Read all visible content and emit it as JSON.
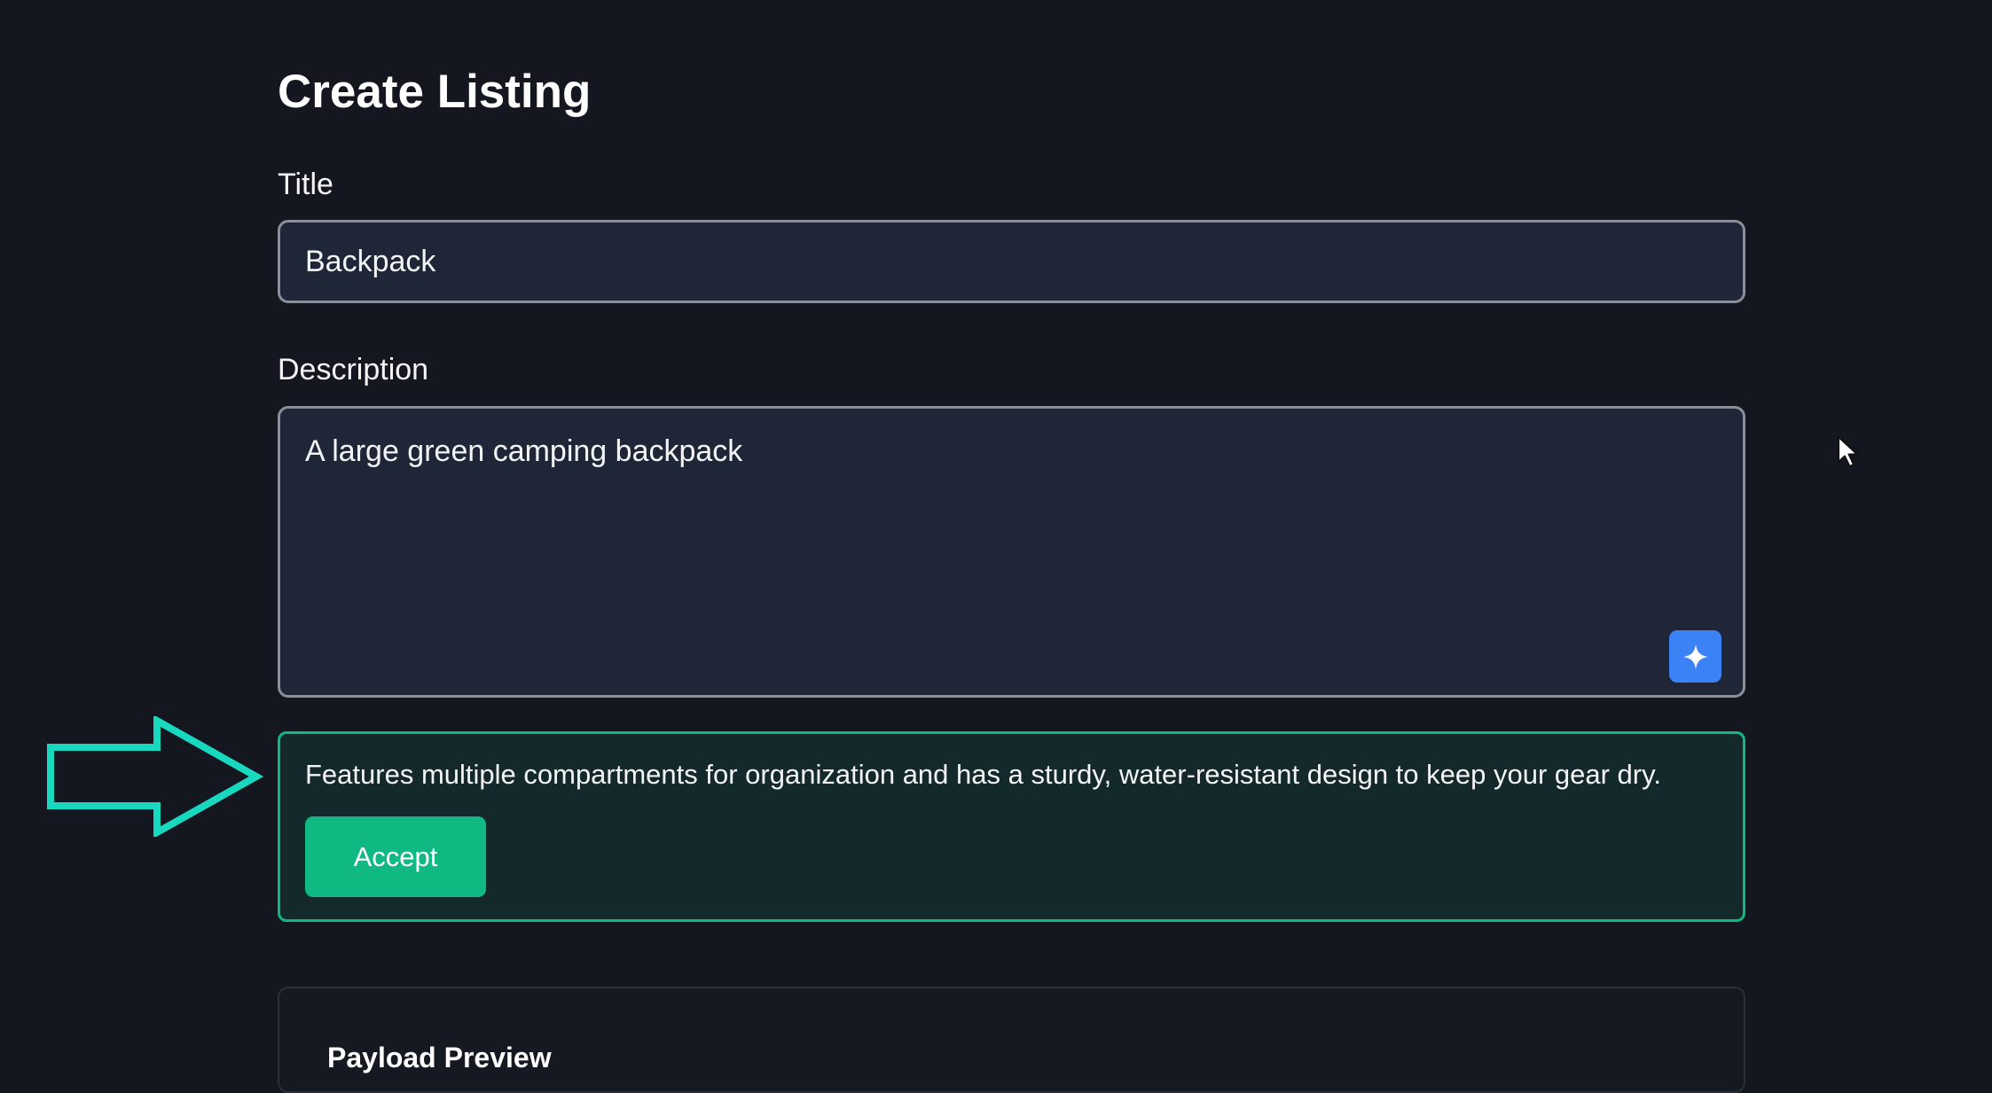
{
  "page": {
    "title": "Create Listing"
  },
  "form": {
    "title_label": "Title",
    "title_value": "Backpack",
    "description_label": "Description",
    "description_value": "A large green camping backpack",
    "ai_button_icon": "sparkle-icon"
  },
  "suggestion": {
    "text": "Features multiple compartments for organization and has a sturdy, water-resistant design to keep your gear dry.",
    "accept_label": "Accept"
  },
  "preview": {
    "title": "Payload Preview"
  },
  "colors": {
    "background": "#14171f",
    "input_background": "#1e2638",
    "accent_blue": "#3b82f6",
    "accent_green": "#10b981",
    "annotation_cyan": "#19d8c0"
  }
}
